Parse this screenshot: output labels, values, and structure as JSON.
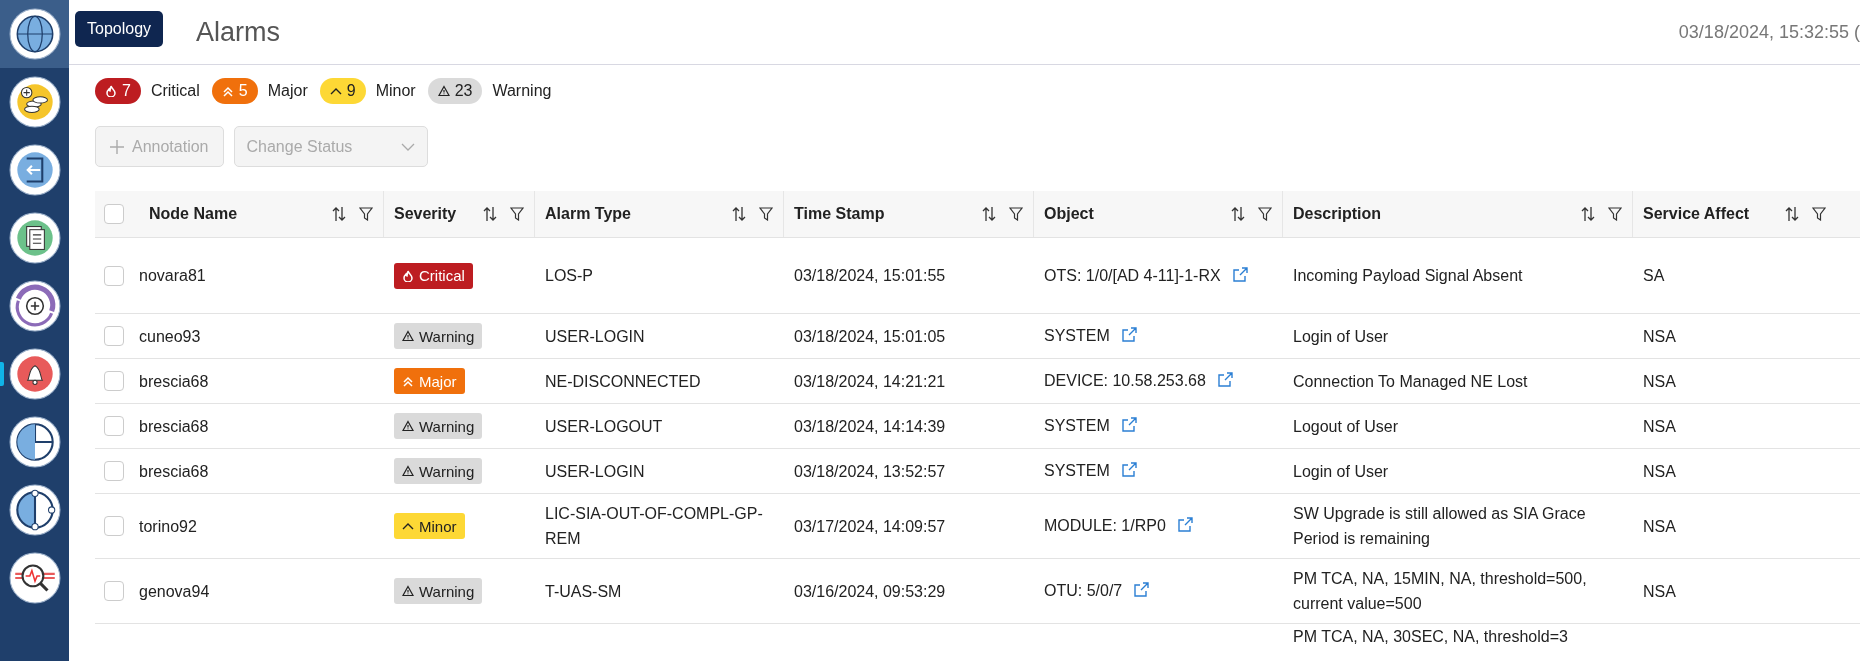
{
  "sidebar": {
    "tooltip": "Topology",
    "items": [
      {
        "kind": "globe",
        "selected": false,
        "hovered": true
      },
      {
        "kind": "coins",
        "selected": false,
        "hovered": false
      },
      {
        "kind": "exit",
        "selected": false,
        "hovered": false
      },
      {
        "kind": "document",
        "selected": false,
        "hovered": false
      },
      {
        "kind": "orbit",
        "selected": false,
        "hovered": false
      },
      {
        "kind": "bell",
        "selected": true,
        "hovered": false
      },
      {
        "kind": "pie",
        "selected": false,
        "hovered": false
      },
      {
        "kind": "network",
        "selected": false,
        "hovered": false
      },
      {
        "kind": "pulse",
        "selected": false,
        "hovered": false
      }
    ]
  },
  "header": {
    "title": "Alarms",
    "timestamp": "03/18/2024, 15:32:55 ("
  },
  "summary": [
    {
      "kind": "critical",
      "count": "7",
      "label": "Critical"
    },
    {
      "kind": "major",
      "count": "5",
      "label": "Major"
    },
    {
      "kind": "minor",
      "count": "9",
      "label": "Minor"
    },
    {
      "kind": "warning",
      "count": "23",
      "label": "Warning"
    }
  ],
  "actions": [
    {
      "kind": "add",
      "label": "Annotation",
      "disabled": true
    },
    {
      "kind": "dropdown",
      "label": "Change Status",
      "disabled": true
    }
  ],
  "table": {
    "all_checked": false,
    "columns": [
      "Node Name",
      "Severity",
      "Alarm Type",
      "Time Stamp",
      "Object",
      "Description",
      "Service Affect"
    ],
    "rows": [
      {
        "checked": false,
        "node": "novara81",
        "severity": {
          "kind": "critical",
          "label": "Critical"
        },
        "alarm_type": "LOS-P",
        "timestamp": "03/18/2024, 15:01:55",
        "object": "OTS: 1/0/[AD 4-11]-1-RX",
        "description": "Incoming Payload Signal Absent",
        "service_affect": "SA"
      },
      {
        "checked": false,
        "node": "cuneo93",
        "severity": {
          "kind": "warning",
          "label": "Warning"
        },
        "alarm_type": "USER-LOGIN",
        "timestamp": "03/18/2024, 15:01:05",
        "object": "SYSTEM",
        "description": "Login of User",
        "service_affect": "NSA"
      },
      {
        "checked": false,
        "node": "brescia68",
        "severity": {
          "kind": "major",
          "label": "Major"
        },
        "alarm_type": "NE-DISCONNECTED",
        "timestamp": "03/18/2024, 14:21:21",
        "object": "DEVICE: 10.58.253.68",
        "description": "Connection To Managed NE Lost",
        "service_affect": "NSA"
      },
      {
        "checked": false,
        "node": "brescia68",
        "severity": {
          "kind": "warning",
          "label": "Warning"
        },
        "alarm_type": "USER-LOGOUT",
        "timestamp": "03/18/2024, 14:14:39",
        "object": "SYSTEM",
        "description": "Logout of User",
        "service_affect": "NSA"
      },
      {
        "checked": false,
        "node": "brescia68",
        "severity": {
          "kind": "warning",
          "label": "Warning"
        },
        "alarm_type": "USER-LOGIN",
        "timestamp": "03/18/2024, 13:52:57",
        "object": "SYSTEM",
        "description": "Login of User",
        "service_affect": "NSA"
      },
      {
        "checked": false,
        "node": "torino92",
        "severity": {
          "kind": "minor",
          "label": "Minor"
        },
        "alarm_type": "LIC-SIA-OUT-OF-COMPL-GP-REM",
        "timestamp": "03/17/2024, 14:09:57",
        "object": "MODULE: 1/RP0",
        "description": "SW Upgrade is still allowed as SIA Grace Period is remaining",
        "service_affect": "NSA"
      },
      {
        "checked": false,
        "node": "genova94",
        "severity": {
          "kind": "warning",
          "label": "Warning"
        },
        "alarm_type": "T-UAS-SM",
        "timestamp": "03/16/2024, 09:53:29",
        "object": "OTU: 5/0/7",
        "description": "PM TCA, NA, 15MIN, NA, threshold=500, current value=500",
        "service_affect": "NSA"
      },
      {
        "description": "PM TCA, NA, 30SEC, NA, threshold=3"
      }
    ]
  }
}
